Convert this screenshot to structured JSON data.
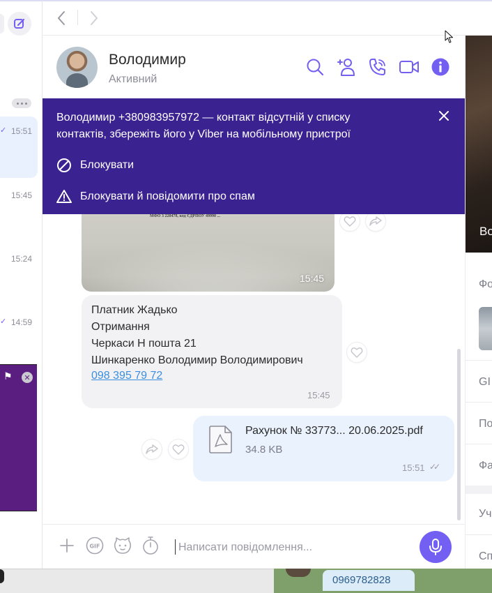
{
  "contact": {
    "name": "Володимир",
    "status": "Активний"
  },
  "banner": {
    "text": "Володимир +380983957972 — контакт відсутній у списку контактів, збережіть його у Viber на мобільному пристрої",
    "block_label": "Блокувати",
    "block_spam_label": "Блокувати й повідомити про спам"
  },
  "chat_list": {
    "times": [
      "15:51",
      "15:45",
      "15:24",
      "14:59"
    ]
  },
  "messages": {
    "image_message": {
      "doc_text": "МФО 3 220478, код ЄДРПОУ 49990 ...",
      "time": "15:45"
    },
    "text_message": {
      "lines": [
        "Платник Жадько",
        "Отримання",
        "Черкаси Н пошта 21",
        "Шинкаренко Володимир Володимирович"
      ],
      "phone_link": "098 395 79 72",
      "time": "15:45"
    },
    "file_message": {
      "file_name": "Рахунок № 33773... 20.06.2025.pdf",
      "file_size": "34.8 KB",
      "time": "15:51"
    }
  },
  "composer": {
    "placeholder": "Написати повідомлення..."
  },
  "right_panel": {
    "photo_caption": "Во",
    "rows": [
      "Фо",
      "GI",
      "По",
      "Фа",
      "Уч",
      "Сп"
    ]
  },
  "bottom": {
    "phone": "0969782828"
  },
  "colors": {
    "accent": "#7360f2",
    "banner": "#3a2291",
    "incoming_bubble": "#f2f2f4",
    "outgoing_bubble": "#eaf2fd",
    "link": "#3b8ee0"
  }
}
